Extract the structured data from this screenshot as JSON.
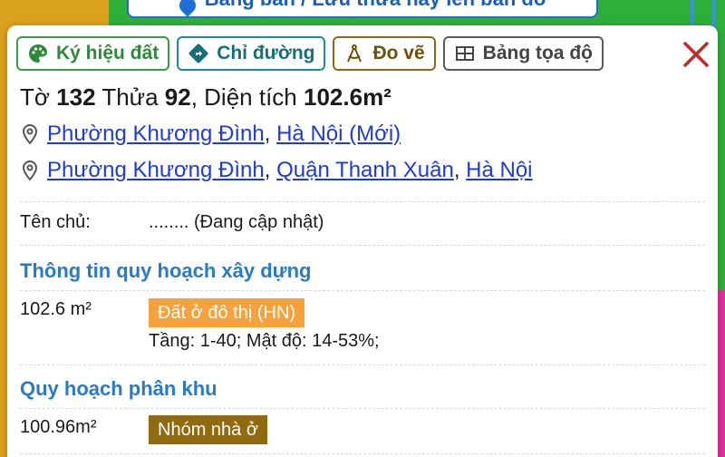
{
  "top_pill": {
    "label": "Bảng bản / Lưu thửa này lên bản đồ"
  },
  "toolbar": {
    "land_symbol": "Ký hiệu đất",
    "directions": "Chỉ đường",
    "measure": "Đo vẽ",
    "coord_table": "Bảng tọa độ"
  },
  "parcel": {
    "sheet_label": "Tờ",
    "sheet_no": "132",
    "lot_label": "Thửa",
    "lot_no": "92",
    "area_label": ", Diện tích",
    "area": "102.6m²"
  },
  "address1": {
    "ward": "Phường Khương Đình",
    "city": "Hà Nội (Mới)"
  },
  "address2": {
    "ward": "Phường Khương Đình",
    "district": "Quận Thanh Xuân",
    "city": "Hà Nội"
  },
  "owner": {
    "label": "Tên chủ:",
    "value": "........ (Đang cập nhật)"
  },
  "construction_planning": {
    "title": "Thông tin quy hoạch xây dựng",
    "area": "102.6 m²",
    "land_type": "Đất ở đô thị (HN)",
    "details": "Tầng: 1-40; Mật độ: 14-53%;"
  },
  "zone_planning": {
    "title": "Quy hoạch phân khu",
    "area": "100.96m²",
    "land_type": "Nhóm nhà ở"
  },
  "colors": {
    "orange_badge": "#f5a23c",
    "olive_badge": "#8f6a10",
    "section_title": "#2a7ac4",
    "link": "#1f3bd1",
    "close": "#c62828"
  }
}
